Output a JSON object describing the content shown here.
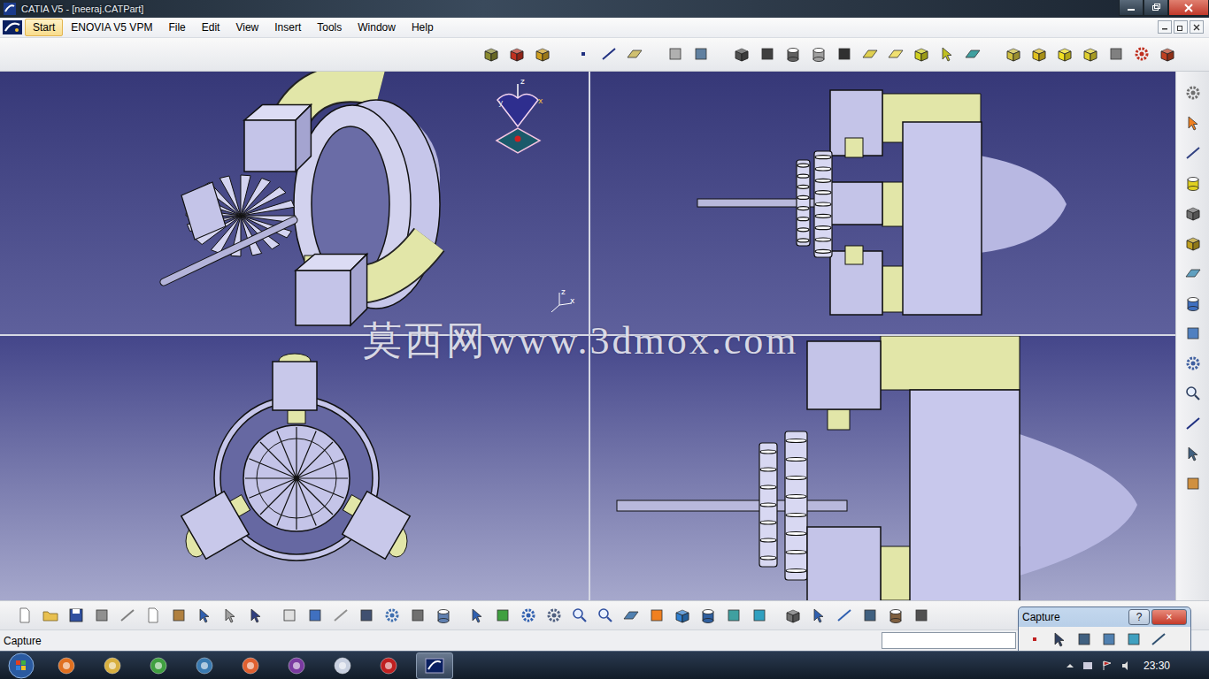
{
  "window": {
    "title": "CATIA V5 - [neeraj.CATPart]"
  },
  "menu": [
    {
      "label": "Start",
      "selected": true
    },
    {
      "label": "ENOVIA V5 VPM",
      "selected": false
    },
    {
      "label": "File",
      "selected": false
    },
    {
      "label": "Edit",
      "selected": false
    },
    {
      "label": "View",
      "selected": false
    },
    {
      "label": "Insert",
      "selected": false
    },
    {
      "label": "Tools",
      "selected": false
    },
    {
      "label": "Window",
      "selected": false
    },
    {
      "label": "Help",
      "selected": false
    }
  ],
  "compass": {
    "labels": [
      "z",
      "x",
      "y"
    ]
  },
  "triad": {
    "labels": [
      "z",
      "x"
    ]
  },
  "watermark": "莫西网www.3dmox.com",
  "status_bar": {
    "text": "Capture"
  },
  "capture_toolbar": {
    "title": "Capture",
    "buttons": [
      {
        "label": "?",
        "kind": "help"
      },
      {
        "label": "×",
        "kind": "close"
      }
    ]
  },
  "taskbar": {
    "clock": "23:30"
  }
}
